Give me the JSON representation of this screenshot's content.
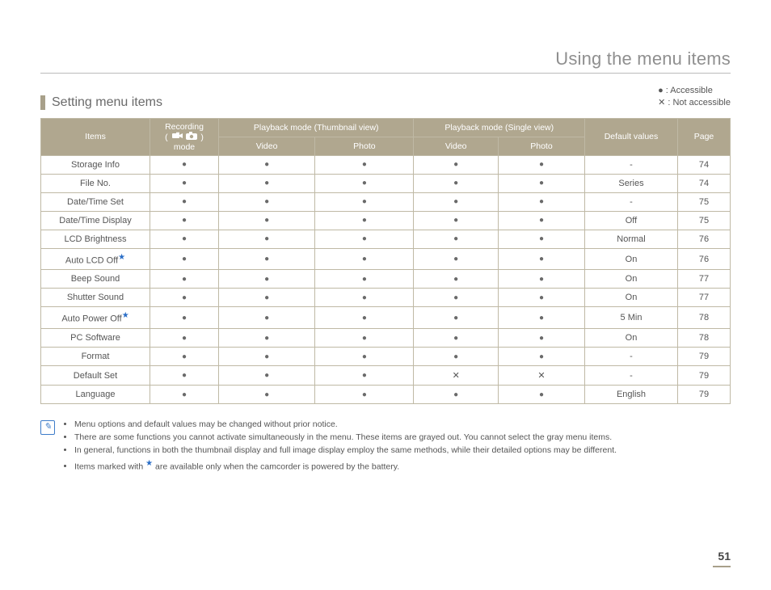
{
  "page_title": "Using the menu items",
  "section_title": "Setting menu items",
  "legend": {
    "accessible_symbol": "●",
    "accessible_label": ": Accessible",
    "not_symbol": "✕",
    "not_label": ": Not accessible"
  },
  "headers": {
    "items": "Items",
    "recording_mode": "Recording",
    "recording_mode2": "mode",
    "thumb": "Playback mode (Thumbnail view)",
    "single": "Playback mode (Single view)",
    "video": "Video",
    "photo": "Photo",
    "default": "Default values",
    "page": "Page"
  },
  "rows": [
    {
      "name": "Storage Info",
      "star": false,
      "rec": "●",
      "tv": "●",
      "tp": "●",
      "sv": "●",
      "sp": "●",
      "def": "-",
      "pg": "74"
    },
    {
      "name": "File No.",
      "star": false,
      "rec": "●",
      "tv": "●",
      "tp": "●",
      "sv": "●",
      "sp": "●",
      "def": "Series",
      "pg": "74"
    },
    {
      "name": "Date/Time Set",
      "star": false,
      "rec": "●",
      "tv": "●",
      "tp": "●",
      "sv": "●",
      "sp": "●",
      "def": "-",
      "pg": "75"
    },
    {
      "name": "Date/Time Display",
      "star": false,
      "rec": "●",
      "tv": "●",
      "tp": "●",
      "sv": "●",
      "sp": "●",
      "def": "Off",
      "pg": "75"
    },
    {
      "name": "LCD Brightness",
      "star": false,
      "rec": "●",
      "tv": "●",
      "tp": "●",
      "sv": "●",
      "sp": "●",
      "def": "Normal",
      "pg": "76"
    },
    {
      "name": "Auto LCD Off",
      "star": true,
      "rec": "●",
      "tv": "●",
      "tp": "●",
      "sv": "●",
      "sp": "●",
      "def": "On",
      "pg": "76"
    },
    {
      "name": "Beep Sound",
      "star": false,
      "rec": "●",
      "tv": "●",
      "tp": "●",
      "sv": "●",
      "sp": "●",
      "def": "On",
      "pg": "77"
    },
    {
      "name": "Shutter Sound",
      "star": false,
      "rec": "●",
      "tv": "●",
      "tp": "●",
      "sv": "●",
      "sp": "●",
      "def": "On",
      "pg": "77"
    },
    {
      "name": "Auto Power Off",
      "star": true,
      "rec": "●",
      "tv": "●",
      "tp": "●",
      "sv": "●",
      "sp": "●",
      "def": "5 Min",
      "pg": "78"
    },
    {
      "name": "PC Software",
      "star": false,
      "rec": "●",
      "tv": "●",
      "tp": "●",
      "sv": "●",
      "sp": "●",
      "def": "On",
      "pg": "78"
    },
    {
      "name": "Format",
      "star": false,
      "rec": "●",
      "tv": "●",
      "tp": "●",
      "sv": "●",
      "sp": "●",
      "def": "-",
      "pg": "79"
    },
    {
      "name": "Default Set",
      "star": false,
      "rec": "●",
      "tv": "●",
      "tp": "●",
      "sv": "✕",
      "sp": "✕",
      "def": "-",
      "pg": "79"
    },
    {
      "name": "Language",
      "star": false,
      "rec": "●",
      "tv": "●",
      "tp": "●",
      "sv": "●",
      "sp": "●",
      "def": "English",
      "pg": "79"
    }
  ],
  "notes": [
    "Menu options and default values may be changed without prior notice.",
    "There are some functions you cannot activate simultaneously in the menu. These items are grayed out. You cannot select the gray menu items.",
    "In general, functions in both the thumbnail display and full image display employ the same methods, while their detailed options may be different.",
    "Items marked with ★ are available only when the camcorder is powered by the battery."
  ],
  "page_number": "51"
}
